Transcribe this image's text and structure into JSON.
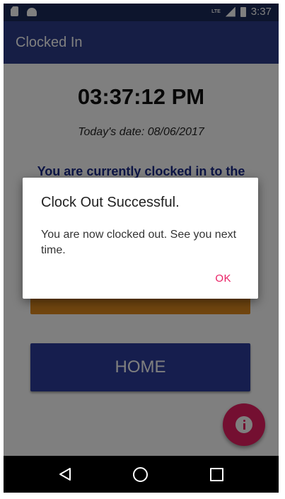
{
  "status_bar": {
    "network": "LTE",
    "time": "3:37"
  },
  "app_bar": {
    "title": "Clocked In"
  },
  "main": {
    "clock": "03:37:12 PM",
    "date_text": "Today's date: 08/06/2017",
    "status_message": "You are currently clocked in to the",
    "home_label": "HOME"
  },
  "dialog": {
    "title": "Clock Out Successful.",
    "message": "You are now clocked out. See you next time.",
    "ok_label": "OK"
  },
  "colors": {
    "app_bar": "#2d3d8b",
    "home_button": "#2d3d9c",
    "accent": "#e91e63",
    "orange_button": "#e08a1e"
  },
  "icons": {
    "fab": "info-icon",
    "nav": [
      "back-icon",
      "home-circle-icon",
      "recents-square-icon"
    ]
  }
}
